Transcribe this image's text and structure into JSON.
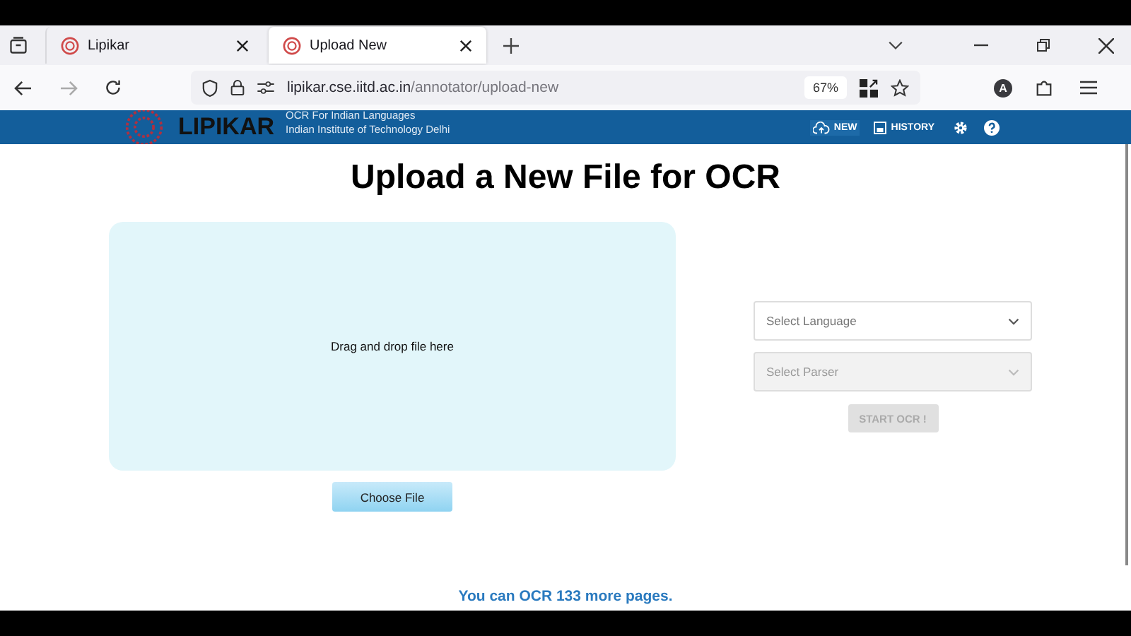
{
  "browser": {
    "tabs": [
      {
        "label": "Lipikar",
        "selected": false
      },
      {
        "label": "Upload New",
        "selected": true
      }
    ],
    "url": {
      "host": "lipikar.cse.iitd.ac.in",
      "path": "/annotator/upload-new"
    },
    "zoom": "67%",
    "profile_initial": "A"
  },
  "header": {
    "brand": "LIPIKAR",
    "subtitle": [
      "OCR For Indian Languages",
      "Indian Institute of Technology Delhi"
    ],
    "nav": [
      {
        "kind": "upload",
        "label": "NEW",
        "hovered": true
      },
      {
        "kind": "history",
        "label": "HISTORY",
        "hovered": false
      }
    ]
  },
  "page": {
    "title": "Upload a New File for OCR",
    "dropzone": "Drag and drop file here",
    "choose_button": "Choose File",
    "selects": [
      {
        "placeholder": "Select Language",
        "disabled": false
      },
      {
        "placeholder": "Select Parser",
        "disabled": true
      }
    ],
    "start_button": {
      "label": "START OCR !",
      "disabled": true
    },
    "quota": "You can OCR 133 more pages."
  }
}
